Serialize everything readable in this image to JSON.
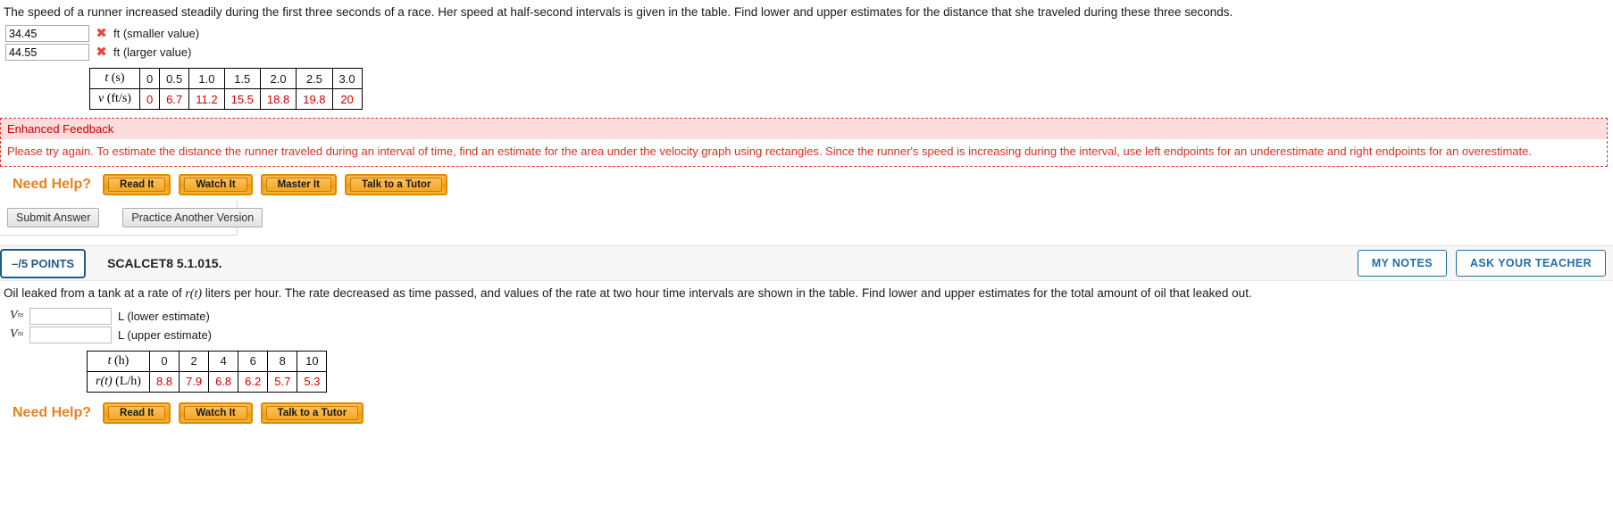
{
  "question1": {
    "prompt": "The speed of a runner increased steadily during the first three seconds of a race. Her speed at half-second intervals is given in the table. Find lower and upper estimates for the distance that she traveled during these three seconds.",
    "answers": [
      {
        "value": "34.45",
        "status_icon": "wrong-mark",
        "unit": "ft (smaller value)"
      },
      {
        "value": "44.55",
        "status_icon": "wrong-mark",
        "unit": "ft (larger value)"
      }
    ],
    "table": {
      "row1_header": "t (s)",
      "row1_header_var": "t",
      "row1_header_unit": " (s)",
      "row1": [
        "0",
        "0.5",
        "1.0",
        "1.5",
        "2.0",
        "2.5",
        "3.0"
      ],
      "row2_header_var": "v",
      "row2_header_unit": " (ft/s)",
      "row2": [
        "0",
        "6.7",
        "11.2",
        "15.5",
        "18.8",
        "19.8",
        "20"
      ]
    },
    "feedback": {
      "title": "Enhanced Feedback",
      "body": "Please try again. To estimate the distance the runner traveled during an interval of time, find an estimate for the area under the velocity graph using rectangles. Since the runner's speed is increasing during the interval, use left endpoints for an underestimate and right endpoints for an overestimate."
    },
    "help": {
      "label": "Need Help?",
      "buttons": [
        "Read It",
        "Watch It",
        "Master It",
        "Talk to a Tutor"
      ]
    },
    "actions": {
      "submit": "Submit Answer",
      "practice": "Practice Another Version"
    }
  },
  "question2": {
    "points": "–/5 POINTS",
    "code": "SCALCET8 5.1.015.",
    "header_buttons": [
      "MY NOTES",
      "ASK YOUR TEACHER"
    ],
    "prompt_part1": "Oil leaked from a tank at a rate of ",
    "prompt_var": "r(t)",
    "prompt_part2": " liters per hour. The rate decreased as time passed, and values of the rate at two hour time intervals are shown in the table. Find lower and upper estimates for the total amount of oil that leaked out.",
    "answers": [
      {
        "label": "V",
        "approx": "≈",
        "value": "",
        "unit": "L (lower estimate)"
      },
      {
        "label": "V",
        "approx": "≈",
        "value": "",
        "unit": "L (upper estimate)"
      }
    ],
    "table": {
      "row1_header_var": "t",
      "row1_header_unit": " (h)",
      "row1": [
        "0",
        "2",
        "4",
        "6",
        "8",
        "10"
      ],
      "row2_header_var": "r(t)",
      "row2_header_unit": " (L/h)",
      "row2": [
        "8.8",
        "7.9",
        "6.8",
        "6.2",
        "5.7",
        "5.3"
      ]
    },
    "help": {
      "label": "Need Help?",
      "buttons": [
        "Read It",
        "Watch It",
        "Talk to a Tutor"
      ]
    }
  },
  "colors": {
    "accent_red": "#d40000",
    "feedback_red": "#d93025",
    "help_orange": "#e8821a",
    "badge_blue": "#1f5c8b"
  }
}
